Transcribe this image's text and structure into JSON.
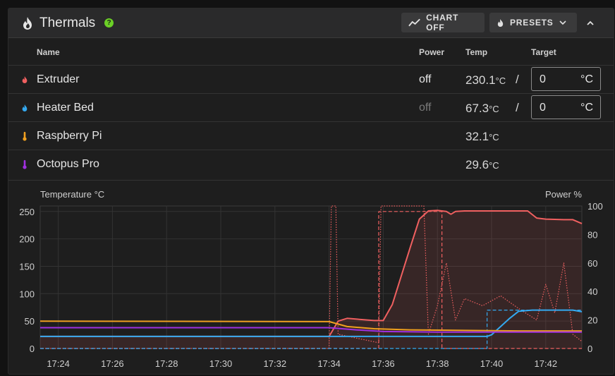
{
  "header": {
    "title": "Thermals",
    "help_glyph": "?",
    "chart_button": "CHART OFF",
    "presets_button": "PRESETS",
    "icons": {
      "title": "fire-icon",
      "chart": "chart-line-icon",
      "presets": "fire-icon",
      "collapse": "chevron-up-icon"
    }
  },
  "table": {
    "headers": {
      "name": "Name",
      "power": "Power",
      "temp": "Temp",
      "target": "Target"
    },
    "rows": [
      {
        "name": "Extruder",
        "icon": "fire-icon",
        "icon_color": "#f06060",
        "power": "off",
        "power_color": "#e6e6e6",
        "temp": "230.1",
        "temp_unit": "°C",
        "slash": "/",
        "target": "0",
        "target_unit": "°C"
      },
      {
        "name": "Heater Bed",
        "icon": "fire-icon",
        "icon_color": "#34a9f0",
        "power": "off",
        "power_color": "#7a7a7a",
        "temp": "67.3",
        "temp_unit": "°C",
        "slash": "/",
        "target": "0",
        "target_unit": "°C"
      },
      {
        "name": "Raspberry Pi",
        "icon": "thermometer-icon",
        "icon_color": "#f0a020",
        "temp": "32.1",
        "temp_unit": "°C"
      },
      {
        "name": "Octopus Pro",
        "icon": "thermometer-icon",
        "icon_color": "#a030e0",
        "temp": "29.6",
        "temp_unit": "°C"
      }
    ]
  },
  "chart_data": {
    "type": "line",
    "ylabel": "Temperature °C",
    "y2label": "Power %",
    "ylim": [
      0,
      260
    ],
    "y2lim": [
      0,
      100
    ],
    "yticks": [
      0,
      50,
      100,
      150,
      200,
      250
    ],
    "y2ticks": [
      0,
      20,
      40,
      60,
      80,
      100
    ],
    "xlim": [
      "17:23:20",
      "17:43:20"
    ],
    "xticks": [
      "17:24",
      "17:26",
      "17:28",
      "17:30",
      "17:32",
      "17:34",
      "17:36",
      "17:38",
      "17:40",
      "17:42"
    ],
    "grid": true,
    "series": [
      {
        "color": "#f06060",
        "style": "solid",
        "axis": "y",
        "points": [
          [
            "17:23:20",
            22
          ],
          [
            "17:34:00",
            22
          ],
          [
            "17:34:20",
            50
          ],
          [
            "17:34:40",
            55
          ],
          [
            "17:35:40",
            51
          ],
          [
            "17:36:00",
            51
          ],
          [
            "17:36:20",
            80
          ],
          [
            "17:37:00",
            185
          ],
          [
            "17:37:20",
            236
          ],
          [
            "17:37:40",
            251
          ],
          [
            "17:38:00",
            252
          ],
          [
            "17:38:20",
            250
          ],
          [
            "17:38:30",
            245
          ],
          [
            "17:38:40",
            250
          ],
          [
            "17:39:00",
            251
          ],
          [
            "17:41:20",
            251
          ],
          [
            "17:41:40",
            238
          ],
          [
            "17:42:00",
            236
          ],
          [
            "17:42:40",
            235
          ],
          [
            "17:43:00",
            235
          ],
          [
            "17:43:20",
            228
          ]
        ]
      },
      {
        "color": "#f06060",
        "style": "dashed",
        "axis": "y",
        "points": [
          [
            "17:23:20",
            0
          ],
          [
            "17:35:50",
            0
          ],
          [
            "17:35:50",
            250
          ],
          [
            "17:38:10",
            250
          ],
          [
            "17:38:10",
            0
          ],
          [
            "17:43:20",
            0
          ]
        ]
      },
      {
        "color": "#f06060",
        "style": "dotted",
        "axis": "y2",
        "points": [
          [
            "17:23:20",
            0
          ],
          [
            "17:34:00",
            0
          ],
          [
            "17:34:05",
            100
          ],
          [
            "17:34:15",
            100
          ],
          [
            "17:34:20",
            10
          ],
          [
            "17:35:50",
            4
          ],
          [
            "17:35:55",
            100
          ],
          [
            "17:37:30",
            100
          ],
          [
            "17:37:40",
            10
          ],
          [
            "17:38:00",
            30
          ],
          [
            "17:38:20",
            60
          ],
          [
            "17:38:40",
            20
          ],
          [
            "17:39:00",
            35
          ],
          [
            "17:39:40",
            30
          ],
          [
            "17:40:20",
            37
          ],
          [
            "17:41:00",
            28
          ],
          [
            "17:41:40",
            20
          ],
          [
            "17:42:00",
            45
          ],
          [
            "17:42:20",
            25
          ],
          [
            "17:42:40",
            60
          ],
          [
            "17:43:00",
            10
          ],
          [
            "17:43:20",
            5
          ]
        ]
      },
      {
        "color": "#34a9f0",
        "style": "solid",
        "axis": "y",
        "points": [
          [
            "17:23:20",
            22
          ],
          [
            "17:39:50",
            22
          ],
          [
            "17:40:00",
            25
          ],
          [
            "17:40:40",
            55
          ],
          [
            "17:41:00",
            68
          ],
          [
            "17:41:30",
            70
          ],
          [
            "17:43:00",
            70
          ],
          [
            "17:43:20",
            67
          ]
        ]
      },
      {
        "color": "#34a9f0",
        "style": "dashed",
        "axis": "y",
        "points": [
          [
            "17:23:20",
            0
          ],
          [
            "17:39:50",
            0
          ],
          [
            "17:39:50",
            70
          ],
          [
            "17:43:20",
            70
          ]
        ]
      },
      {
        "color": "#f0a020",
        "style": "solid",
        "axis": "y",
        "points": [
          [
            "17:23:20",
            50
          ],
          [
            "17:34:00",
            49
          ],
          [
            "17:34:40",
            40
          ],
          [
            "17:35:40",
            36
          ],
          [
            "17:37:00",
            34
          ],
          [
            "17:39:00",
            33
          ],
          [
            "17:41:00",
            32
          ],
          [
            "17:43:20",
            32
          ]
        ]
      },
      {
        "color": "#a030e0",
        "style": "solid",
        "axis": "y",
        "points": [
          [
            "17:23:20",
            38
          ],
          [
            "17:34:00",
            38
          ],
          [
            "17:35:00",
            34
          ],
          [
            "17:36:00",
            31
          ],
          [
            "17:38:00",
            30
          ],
          [
            "17:43:20",
            30
          ]
        ]
      }
    ]
  }
}
